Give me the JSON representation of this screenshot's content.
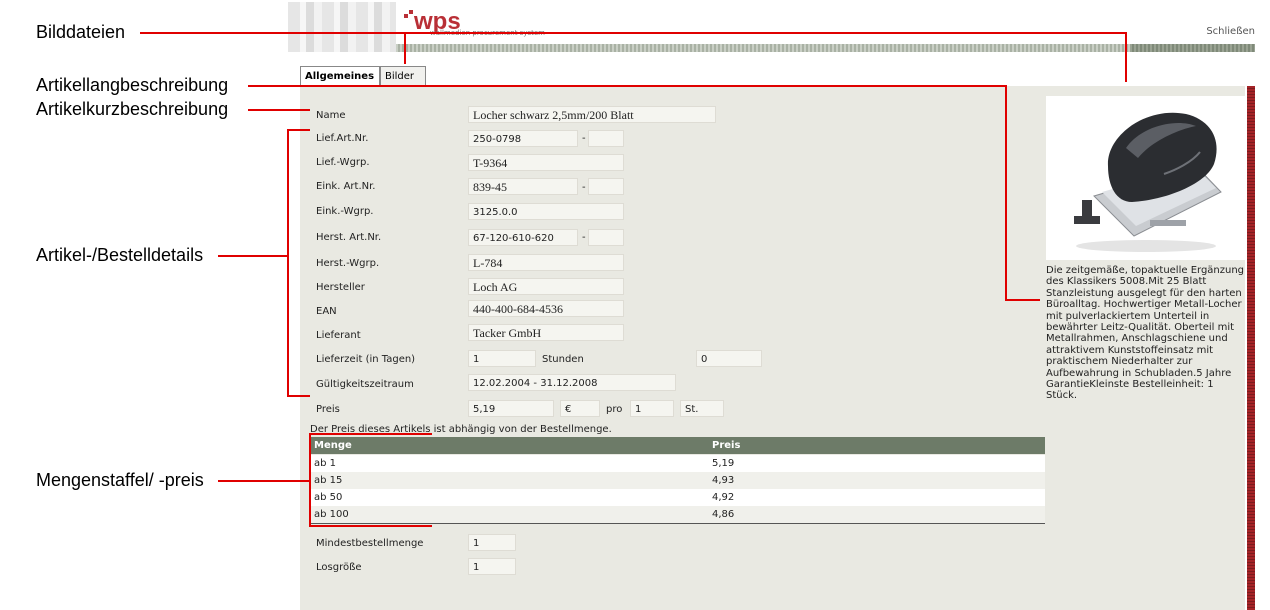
{
  "annotations": {
    "bilddateien": "Bilddateien",
    "artikellang": "Artikellangbeschreibung",
    "artikelkurz": "Artikelkurzbeschreibung",
    "details": "Artikel-/Bestelldetails",
    "mengenstaffel": "Mengenstaffel/ -preis"
  },
  "header": {
    "logo": "wps",
    "logo_sub": "wallmedien procurement system",
    "close_label": "Schließen"
  },
  "tabs": [
    {
      "label": "Allgemeines",
      "active": true
    },
    {
      "label": "Bilder",
      "active": false
    }
  ],
  "fields": {
    "name": {
      "label": "Name",
      "value": "Locher schwarz 2,5mm/200 Blatt"
    },
    "lief_art_nr": {
      "label": "Lief.Art.Nr.",
      "value": "250-0798",
      "sep": "-"
    },
    "lief_wgrp": {
      "label": "Lief.-Wgrp.",
      "value": "T-9364"
    },
    "eink_art_nr": {
      "label": "Eink. Art.Nr.",
      "value": "839-45",
      "sep": "-"
    },
    "eink_wgrp": {
      "label": "Eink.-Wgrp.",
      "value": "3125.0.0"
    },
    "herst_art_nr": {
      "label": "Herst. Art.Nr.",
      "value": "67-120-610-620",
      "sep": "-"
    },
    "herst_wgrp": {
      "label": "Herst.-Wgrp.",
      "value": "L-784"
    },
    "hersteller": {
      "label": "Hersteller",
      "value": "Loch AG"
    },
    "ean": {
      "label": "EAN",
      "value": "440-400-684-4536"
    },
    "lieferant": {
      "label": "Lieferant",
      "value": "Tacker GmbH"
    },
    "lieferzeit": {
      "label": "Lieferzeit (in Tagen)",
      "value": "1",
      "stunden_label": "Stunden",
      "stunden_value": "0"
    },
    "gueltigkeit": {
      "label": "Gültigkeitszeitraum",
      "value": "12.02.2004 - 31.12.2008"
    },
    "preis": {
      "label": "Preis",
      "value": "5,19",
      "currency": "€",
      "pro_label": "pro",
      "pro_value": "1",
      "unit": "St."
    },
    "mindest": {
      "label": "Mindestbestellmenge",
      "value": "1"
    },
    "losgroesse": {
      "label": "Losgröße",
      "value": "1"
    }
  },
  "price_note": "Der Preis dieses Artikels ist abhängig von der Bestellmenge.",
  "staffel": {
    "headers": [
      "Menge",
      "Preis"
    ],
    "rows": [
      [
        "ab 1",
        "5,19"
      ],
      [
        "ab 15",
        "4,93"
      ],
      [
        "ab 50",
        "4,92"
      ],
      [
        "ab 100",
        "4,86"
      ]
    ]
  },
  "description": "Die zeitgemäße, topaktuelle Ergänzung des Klassikers 5008.Mit 25 Blatt Stanzleistung ausgelegt für den harten Büroalltag. Hochwertiger Metall-Locher mit pulverlackiertem Unterteil in bewährter Leitz-Qualität. Oberteil mit Metallrahmen, Anschlagschiene und attraktivem Kunststoffeinsatz mit praktischem Niederhalter zur Aufbewahrung in Schubladen.5 Jahre GarantieKleinste Bestelleinheit: 1 Stück.",
  "colors": {
    "annotation_line": "#e00000",
    "table_header": "#6d7b68",
    "logo": "#b92f36"
  }
}
